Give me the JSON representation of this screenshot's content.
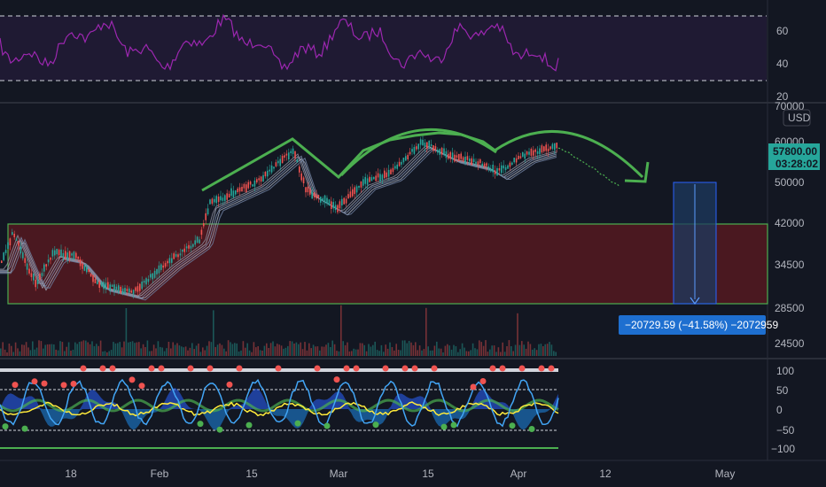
{
  "colors": {
    "background": "#131722",
    "grid": "#2a2e39",
    "rsi_line": "#9c27b0",
    "rsi_band": "#2a1f3a",
    "zone_fill": "#5b1a24",
    "zone_border": "#4caf50",
    "arc_green": "#4caf50",
    "measure_blue": "#2962ff",
    "price_badge": "#26a69a",
    "measure_label_bg": "#1e6fd0"
  },
  "rsi_panel": {
    "tick_labels": [
      "60",
      "40",
      "20"
    ]
  },
  "price_panel": {
    "tick_labels": [
      "70000",
      "60000",
      "50000",
      "42000",
      "34500",
      "28500",
      "24500"
    ],
    "currency": "USD",
    "last_price": "57800.00",
    "countdown": "03:28:02",
    "measure_label": "−20729.59 (−41.58%) −2072959"
  },
  "oscillator_panel": {
    "tick_labels": [
      "100",
      "50",
      "0",
      "−50",
      "−100"
    ]
  },
  "time_axis": {
    "labels": [
      "18",
      "Feb",
      "15",
      "Mar",
      "15",
      "Apr",
      "12",
      "May"
    ]
  },
  "icons": {
    "measure_arrow": "arrow-down-icon"
  }
}
